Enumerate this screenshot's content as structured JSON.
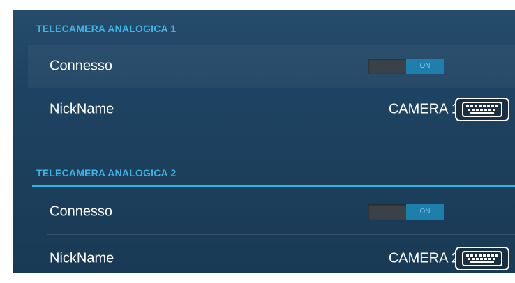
{
  "section1": {
    "title": "TELECAMERA ANALOGICA 1",
    "connected": {
      "label": "Connesso",
      "toggle_state": "ON"
    },
    "nickname": {
      "label": "NickName",
      "value": "CAMERA 1"
    }
  },
  "section2": {
    "title": "TELECAMERA ANALOGICA 2",
    "connected": {
      "label": "Connesso",
      "toggle_state": "ON"
    },
    "nickname": {
      "label": "NickName",
      "value": "CAMERA 2"
    }
  },
  "icons": {
    "keyboard": "keyboard-icon"
  },
  "colors": {
    "section_title": "#3fb4e6",
    "toggle_on": "#1e7fad",
    "accent_divider": "#31b3e6"
  }
}
